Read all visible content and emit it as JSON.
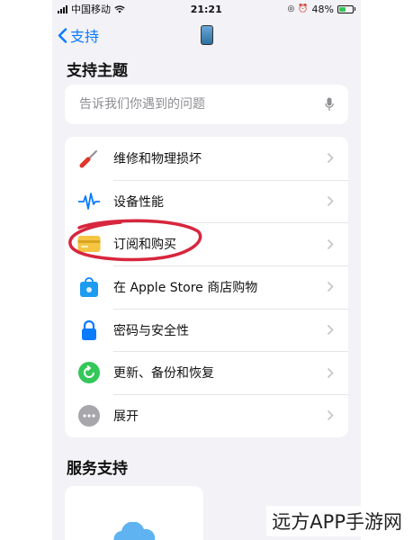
{
  "status_bar": {
    "carrier": "中国移动",
    "time": "21:21",
    "battery_percent": "48%"
  },
  "nav": {
    "back_label": "支持"
  },
  "support_topics": {
    "title": "支持主题",
    "search_placeholder": "告诉我们你遇到的问题",
    "items": [
      {
        "label": "维修和物理损坏",
        "icon": "screwdriver-icon"
      },
      {
        "label": "设备性能",
        "icon": "pulse-icon"
      },
      {
        "label": "订阅和购买",
        "icon": "wallet-card-icon"
      },
      {
        "label": "在 Apple Store 商店购物",
        "icon": "apple-store-bag-icon"
      },
      {
        "label": "密码与安全性",
        "icon": "lock-icon"
      },
      {
        "label": "更新、备份和恢复",
        "icon": "restore-icon"
      },
      {
        "label": "展开",
        "icon": "more-icon"
      }
    ]
  },
  "services": {
    "title": "服务支持",
    "card_icon": "icloud-icon"
  },
  "watermark": "远方APP手游网",
  "colors": {
    "accent": "#0a7aff",
    "annotation": "#d7263d",
    "background": "#f2f2f7"
  }
}
